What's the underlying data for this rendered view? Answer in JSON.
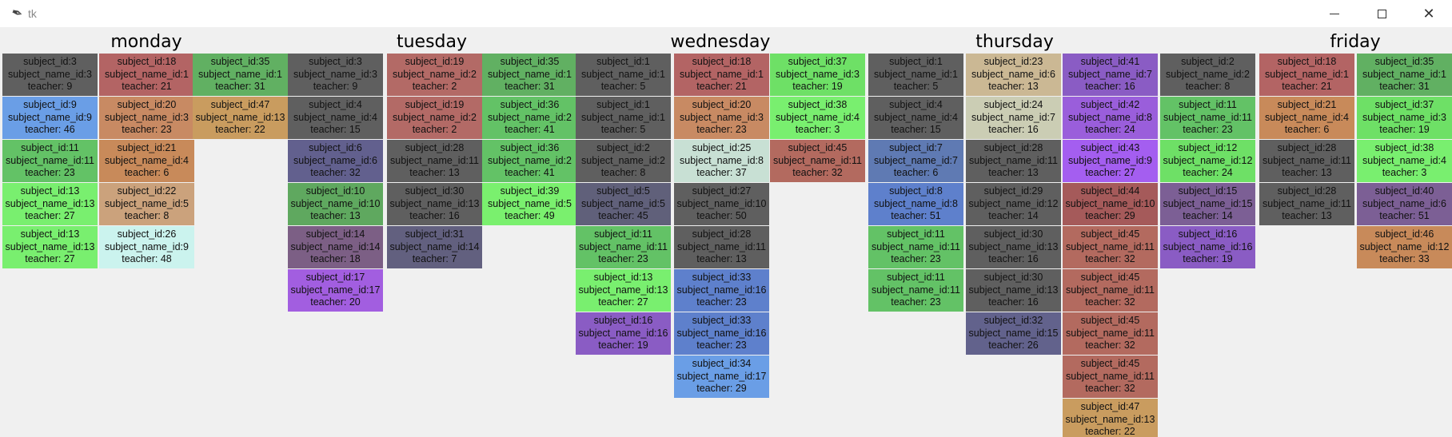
{
  "window": {
    "title": "tk"
  },
  "days": [
    {
      "name": "monday",
      "columns": [
        [
          {
            "sid": "subject_id:3",
            "snid": "subject_name_id:3",
            "t": "teacher: 9",
            "color": "#5f5f5f"
          },
          {
            "sid": "subject_id:9",
            "snid": "subject_name_id:9",
            "t": "teacher: 46",
            "color": "#6a9ee6"
          },
          {
            "sid": "subject_id:11",
            "snid": "subject_name_id:11",
            "t": "teacher: 23",
            "color": "#63c266"
          },
          {
            "sid": "subject_id:13",
            "snid": "subject_name_id:13",
            "t": "teacher: 27",
            "color": "#79ef6f"
          },
          {
            "sid": "subject_id:13",
            "snid": "subject_name_id:13",
            "t": "teacher: 27",
            "color": "#79ef6f"
          }
        ],
        [
          {
            "sid": "subject_id:18",
            "snid": "subject_name_id:1",
            "t": "teacher: 21",
            "color": "#b36464"
          },
          {
            "sid": "subject_id:20",
            "snid": "subject_name_id:3",
            "t": "teacher: 23",
            "color": "#c88a63"
          },
          {
            "sid": "subject_id:21",
            "snid": "subject_name_id:4",
            "t": "teacher: 6",
            "color": "#c88a5a"
          },
          {
            "sid": "subject_id:22",
            "snid": "subject_name_id:5",
            "t": "teacher: 8",
            "color": "#cba27c"
          },
          {
            "sid": "subject_id:26",
            "snid": "subject_name_id:9",
            "t": "teacher: 48",
            "color": "#cbf3ee"
          }
        ],
        [
          {
            "sid": "subject_id:35",
            "snid": "subject_name_id:1",
            "t": "teacher: 31",
            "color": "#61b062"
          },
          {
            "sid": "subject_id:47",
            "snid": "subject_name_id:13",
            "t": "teacher: 22",
            "color": "#c99c5f"
          }
        ]
      ]
    },
    {
      "name": "tuesday",
      "columns": [
        [
          {
            "sid": "subject_id:3",
            "snid": "subject_name_id:3",
            "t": "teacher: 9",
            "color": "#5f5f5f"
          },
          {
            "sid": "subject_id:4",
            "snid": "subject_name_id:4",
            "t": "teacher: 15",
            "color": "#5f5f5f"
          },
          {
            "sid": "subject_id:6",
            "snid": "subject_name_id:6",
            "t": "teacher: 32",
            "color": "#62608e"
          },
          {
            "sid": "subject_id:10",
            "snid": "subject_name_id:10",
            "t": "teacher: 13",
            "color": "#5fa85f"
          },
          {
            "sid": "subject_id:14",
            "snid": "subject_name_id:14",
            "t": "teacher: 18",
            "color": "#7c5f85"
          },
          {
            "sid": "subject_id:17",
            "snid": "subject_name_id:17",
            "t": "teacher: 20",
            "color": "#a25ee0"
          }
        ],
        [
          {
            "sid": "subject_id:19",
            "snid": "subject_name_id:2",
            "t": "teacher: 2",
            "color": "#b36a66"
          },
          {
            "sid": "subject_id:19",
            "snid": "subject_name_id:2",
            "t": "teacher: 2",
            "color": "#b36a66"
          },
          {
            "sid": "subject_id:28",
            "snid": "subject_name_id:11",
            "t": "teacher: 13",
            "color": "#5f5f5f"
          },
          {
            "sid": "subject_id:30",
            "snid": "subject_name_id:13",
            "t": "teacher: 16",
            "color": "#5f5f5f"
          },
          {
            "sid": "subject_id:31",
            "snid": "subject_name_id:14",
            "t": "teacher: 7",
            "color": "#62607f"
          }
        ],
        [
          {
            "sid": "subject_id:35",
            "snid": "subject_name_id:1",
            "t": "teacher: 31",
            "color": "#61b062"
          },
          {
            "sid": "subject_id:36",
            "snid": "subject_name_id:2",
            "t": "teacher: 41",
            "color": "#63c266"
          },
          {
            "sid": "subject_id:36",
            "snid": "subject_name_id:2",
            "t": "teacher: 41",
            "color": "#63c266"
          },
          {
            "sid": "subject_id:39",
            "snid": "subject_name_id:5",
            "t": "teacher: 49",
            "color": "#7af06e"
          }
        ]
      ]
    },
    {
      "name": "wednesday",
      "columns": [
        [
          {
            "sid": "subject_id:1",
            "snid": "subject_name_id:1",
            "t": "teacher: 5",
            "color": "#5f5f5f"
          },
          {
            "sid": "subject_id:1",
            "snid": "subject_name_id:1",
            "t": "teacher: 5",
            "color": "#5f5f5f"
          },
          {
            "sid": "subject_id:2",
            "snid": "subject_name_id:2",
            "t": "teacher: 8",
            "color": "#5f5f5f"
          },
          {
            "sid": "subject_id:5",
            "snid": "subject_name_id:5",
            "t": "teacher: 45",
            "color": "#60607a"
          },
          {
            "sid": "subject_id:11",
            "snid": "subject_name_id:11",
            "t": "teacher: 23",
            "color": "#63c266"
          },
          {
            "sid": "subject_id:13",
            "snid": "subject_name_id:13",
            "t": "teacher: 27",
            "color": "#79ef6f"
          },
          {
            "sid": "subject_id:16",
            "snid": "subject_name_id:16",
            "t": "teacher: 19",
            "color": "#8a5cc4"
          }
        ],
        [
          {
            "sid": "subject_id:18",
            "snid": "subject_name_id:1",
            "t": "teacher: 21",
            "color": "#b36464"
          },
          {
            "sid": "subject_id:20",
            "snid": "subject_name_id:3",
            "t": "teacher: 23",
            "color": "#c88a63"
          },
          {
            "sid": "subject_id:25",
            "snid": "subject_name_id:8",
            "t": "teacher: 37",
            "color": "#c8e0d4"
          },
          {
            "sid": "subject_id:27",
            "snid": "subject_name_id:10",
            "t": "teacher: 50",
            "color": "#5f5f5f"
          },
          {
            "sid": "subject_id:28",
            "snid": "subject_name_id:11",
            "t": "teacher: 13",
            "color": "#5f5f5f"
          },
          {
            "sid": "subject_id:33",
            "snid": "subject_name_id:16",
            "t": "teacher: 23",
            "color": "#5e80cc"
          },
          {
            "sid": "subject_id:33",
            "snid": "subject_name_id:16",
            "t": "teacher: 23",
            "color": "#5e80cc"
          },
          {
            "sid": "subject_id:34",
            "snid": "subject_name_id:17",
            "t": "teacher: 29",
            "color": "#6a9ee6"
          }
        ],
        [
          {
            "sid": "subject_id:37",
            "snid": "subject_name_id:3",
            "t": "teacher: 19",
            "color": "#6ee066"
          },
          {
            "sid": "subject_id:38",
            "snid": "subject_name_id:4",
            "t": "teacher: 3",
            "color": "#79ef6f"
          },
          {
            "sid": "subject_id:45",
            "snid": "subject_name_id:11",
            "t": "teacher: 32",
            "color": "#b36a5f"
          }
        ]
      ]
    },
    {
      "name": "thursday",
      "columns": [
        [
          {
            "sid": "subject_id:1",
            "snid": "subject_name_id:1",
            "t": "teacher: 5",
            "color": "#5f5f5f"
          },
          {
            "sid": "subject_id:4",
            "snid": "subject_name_id:4",
            "t": "teacher: 15",
            "color": "#5f5f5f"
          },
          {
            "sid": "subject_id:7",
            "snid": "subject_name_id:7",
            "t": "teacher: 6",
            "color": "#5f7ab3"
          },
          {
            "sid": "subject_id:8",
            "snid": "subject_name_id:8",
            "t": "teacher: 51",
            "color": "#5e80cc"
          },
          {
            "sid": "subject_id:11",
            "snid": "subject_name_id:11",
            "t": "teacher: 23",
            "color": "#63c266"
          },
          {
            "sid": "subject_id:11",
            "snid": "subject_name_id:11",
            "t": "teacher: 23",
            "color": "#63c266"
          }
        ],
        [
          {
            "sid": "subject_id:23",
            "snid": "subject_name_id:6",
            "t": "teacher: 13",
            "color": "#cbb894"
          },
          {
            "sid": "subject_id:24",
            "snid": "subject_name_id:7",
            "t": "teacher: 16",
            "color": "#cbcdb4"
          },
          {
            "sid": "subject_id:28",
            "snid": "subject_name_id:11",
            "t": "teacher: 13",
            "color": "#5f5f5f"
          },
          {
            "sid": "subject_id:29",
            "snid": "subject_name_id:12",
            "t": "teacher: 14",
            "color": "#5f5f5f"
          },
          {
            "sid": "subject_id:30",
            "snid": "subject_name_id:13",
            "t": "teacher: 16",
            "color": "#5f5f5f"
          },
          {
            "sid": "subject_id:30",
            "snid": "subject_name_id:13",
            "t": "teacher: 16",
            "color": "#5f5f5f"
          },
          {
            "sid": "subject_id:32",
            "snid": "subject_name_id:15",
            "t": "teacher: 26",
            "color": "#62628c"
          }
        ],
        [
          {
            "sid": "subject_id:41",
            "snid": "subject_name_id:7",
            "t": "teacher: 16",
            "color": "#8a5cc4"
          },
          {
            "sid": "subject_id:42",
            "snid": "subject_name_id:8",
            "t": "teacher: 24",
            "color": "#9a5edb"
          },
          {
            "sid": "subject_id:43",
            "snid": "subject_name_id:9",
            "t": "teacher: 27",
            "color": "#a45ef0"
          },
          {
            "sid": "subject_id:44",
            "snid": "subject_name_id:10",
            "t": "teacher: 29",
            "color": "#a55a5a"
          },
          {
            "sid": "subject_id:45",
            "snid": "subject_name_id:11",
            "t": "teacher: 32",
            "color": "#b36a5f"
          },
          {
            "sid": "subject_id:45",
            "snid": "subject_name_id:11",
            "t": "teacher: 32",
            "color": "#b36a5f"
          },
          {
            "sid": "subject_id:45",
            "snid": "subject_name_id:11",
            "t": "teacher: 32",
            "color": "#b36a5f"
          },
          {
            "sid": "subject_id:45",
            "snid": "subject_name_id:11",
            "t": "teacher: 32",
            "color": "#b36a5f"
          },
          {
            "sid": "subject_id:47",
            "snid": "subject_name_id:13",
            "t": "teacher: 22",
            "color": "#c99c5f"
          }
        ],
        [
          {
            "sid": "subject_id:2",
            "snid": "subject_name_id:2",
            "t": "teacher: 8",
            "color": "#5f5f5f"
          },
          {
            "sid": "subject_id:11",
            "snid": "subject_name_id:11",
            "t": "teacher: 23",
            "color": "#63c266"
          },
          {
            "sid": "subject_id:12",
            "snid": "subject_name_id:12",
            "t": "teacher: 24",
            "color": "#6ee066"
          },
          {
            "sid": "subject_id:15",
            "snid": "subject_name_id:15",
            "t": "teacher: 14",
            "color": "#7c5f95"
          },
          {
            "sid": "subject_id:16",
            "snid": "subject_name_id:16",
            "t": "teacher: 19",
            "color": "#8a5cc4"
          }
        ]
      ]
    },
    {
      "name": "friday",
      "columns": [
        [
          {
            "sid": "subject_id:18",
            "snid": "subject_name_id:1",
            "t": "teacher: 21",
            "color": "#b36464"
          },
          {
            "sid": "subject_id:21",
            "snid": "subject_name_id:4",
            "t": "teacher: 6",
            "color": "#c88a5a"
          },
          {
            "sid": "subject_id:28",
            "snid": "subject_name_id:11",
            "t": "teacher: 13",
            "color": "#5f5f5f"
          },
          {
            "sid": "subject_id:28",
            "snid": "subject_name_id:11",
            "t": "teacher: 13",
            "color": "#5f5f5f"
          }
        ],
        [
          {
            "sid": "subject_id:35",
            "snid": "subject_name_id:1",
            "t": "teacher: 31",
            "color": "#61b062"
          },
          {
            "sid": "subject_id:37",
            "snid": "subject_name_id:3",
            "t": "teacher: 19",
            "color": "#6ee066"
          },
          {
            "sid": "subject_id:38",
            "snid": "subject_name_id:4",
            "t": "teacher: 3",
            "color": "#79ef6f"
          },
          {
            "sid": "subject_id:40",
            "snid": "subject_name_id:6",
            "t": "teacher: 51",
            "color": "#7c5f95"
          },
          {
            "sid": "subject_id:46",
            "snid": "subject_name_id:12",
            "t": "teacher: 33",
            "color": "#c88a5a"
          }
        ]
      ]
    }
  ]
}
